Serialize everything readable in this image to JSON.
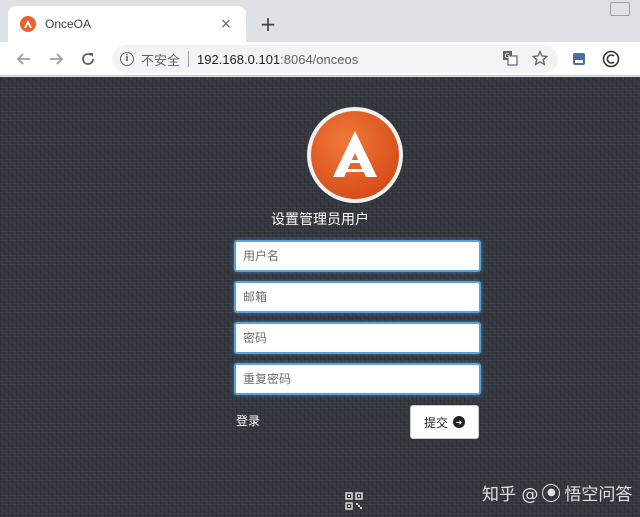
{
  "tab": {
    "title": "OnceOA",
    "close": "×"
  },
  "newtab": "+",
  "address": {
    "security_label": "不安全",
    "host": "192.168.0.101",
    "rest": ":8064/onceos"
  },
  "form": {
    "title": "设置管理员用户",
    "fields": [
      {
        "placeholder": "用户名"
      },
      {
        "placeholder": "邮箱"
      },
      {
        "placeholder": "密码"
      },
      {
        "placeholder": "重复密码"
      }
    ],
    "login_label": "登录",
    "submit_label": "提交"
  },
  "watermark": {
    "prefix": "知乎 @",
    "text": "悟空问答"
  },
  "colors": {
    "brand_orange": "#e8612c",
    "field_border": "#5aa3d8",
    "page_bg": "#33363d"
  },
  "icons": [
    "onceoa-logo-icon",
    "close-icon",
    "plus-icon",
    "back-icon",
    "forward-icon",
    "reload-icon",
    "info-icon",
    "translate-icon",
    "star-icon",
    "extension-icon",
    "account-icon",
    "arrow-circle-right-icon",
    "qr-code-icon"
  ]
}
